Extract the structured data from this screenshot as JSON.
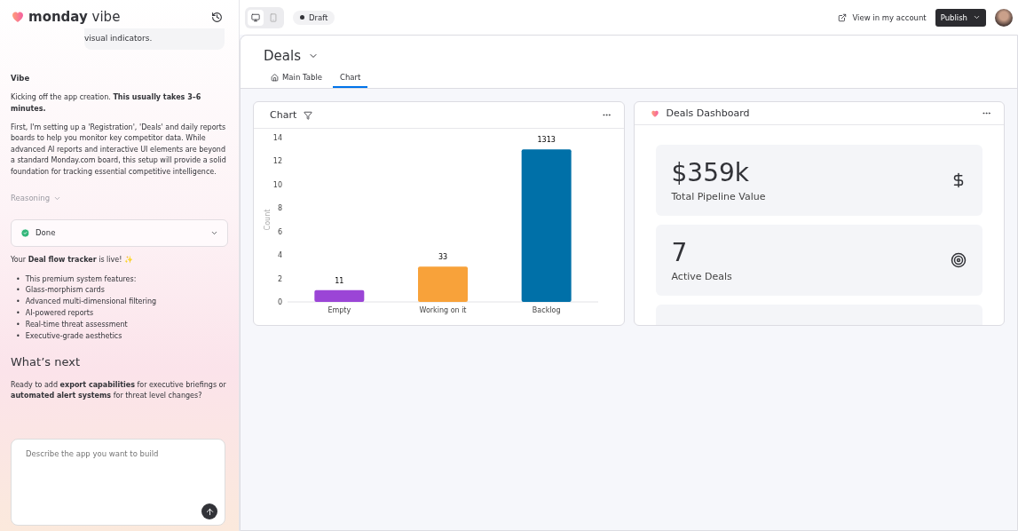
{
  "sidebar": {
    "logo": {
      "brand": "monday",
      "product": "vibe"
    },
    "bubble": "visual indicators.",
    "messages": [
      {
        "kind": "heading",
        "text": "Vibe"
      },
      {
        "kind": "para",
        "text": "Kicking off the app creation. **This usually takes 3–6 minutes.**"
      },
      {
        "kind": "para",
        "text": "First, I'm setting up a 'Registration', 'Deals' and daily reports boards to help you monitor key competitor data. While advanced AI reports and interactive UI elements are beyond a standard Monday.com board, this setup will provide a solid foundation for tracking essential competitive intelligence."
      },
      {
        "kind": "reasoning",
        "text": "Reasoning"
      },
      {
        "kind": "status",
        "text": "Done"
      },
      {
        "kind": "para",
        "text": "Your **Deal flow tracker** is live! ✨"
      },
      {
        "kind": "list",
        "marker": "•",
        "items": [
          "This premium system features:",
          "Glass-morphism cards",
          "Advanced multi-dimensional filtering",
          "AI-powered reports",
          "Real-time threat assessment",
          "Executive-grade aesthetics"
        ]
      },
      {
        "kind": "title",
        "text": "What’s next"
      },
      {
        "kind": "para",
        "text": "Ready to add **export capabilities** for executive briefings or **automated alert systems** for threat level changes?"
      }
    ],
    "composer": {
      "placeholder": "Describe the app you want to build"
    }
  },
  "topbar": {
    "devices": [
      {
        "kind": "desktop",
        "selected": true
      },
      {
        "kind": "mobile",
        "selected": false
      }
    ],
    "status": "Draft",
    "view_link": "View in my account",
    "publish": "Publish"
  },
  "board": {
    "title": "Deals",
    "tabs": [
      {
        "label": "Main Table",
        "kind": "home",
        "selected": false
      },
      {
        "label": "Chart",
        "kind": "plain",
        "selected": true
      }
    ],
    "chart_widget": {
      "title": "Chart",
      "chart_data": {
        "type": "bar",
        "ylabel": "Count",
        "categories": [
          "Empty",
          "Working on it",
          "Backlog"
        ],
        "values": [
          1,
          3,
          13
        ],
        "colors": [
          "#9b45d6",
          "#f8a23a",
          "#0070a8"
        ],
        "ylim": [
          0,
          14
        ],
        "yticks": [
          0,
          2,
          4,
          6,
          8,
          10,
          12,
          14
        ],
        "annotations": [
          "11",
          "33",
          "1313"
        ]
      }
    },
    "dashboard": {
      "title": "Deals Dashboard",
      "stats": [
        {
          "value": "$359k",
          "label": "Total Pipeline Value",
          "kind": "currency"
        },
        {
          "value": "7",
          "label": "Active Deals",
          "kind": "count"
        }
      ]
    }
  }
}
